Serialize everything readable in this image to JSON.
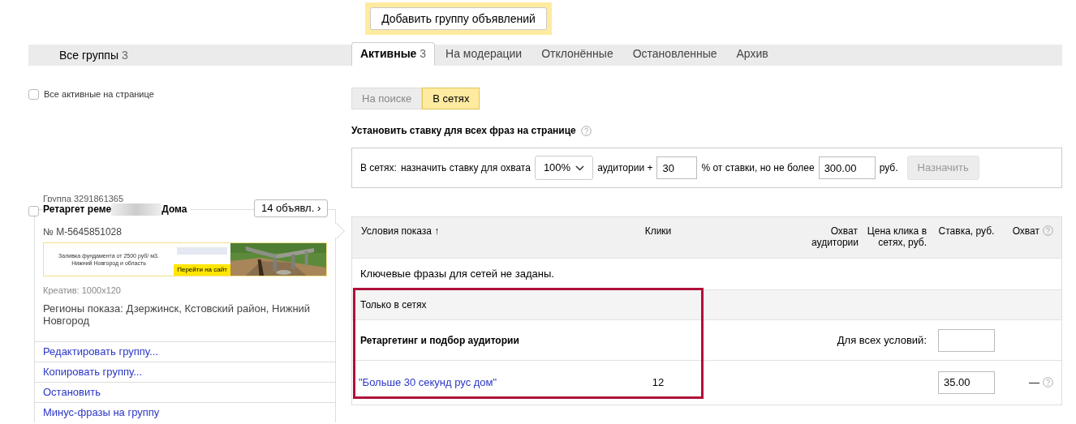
{
  "add_button": "Добавить группу объявлений",
  "all_groups": {
    "label": "Все группы",
    "count": "3"
  },
  "tabs": [
    {
      "label": "Активные",
      "count": "3",
      "selected": true
    },
    {
      "label": "На модерации",
      "selected": false
    },
    {
      "label": "Отклонённые",
      "selected": false
    },
    {
      "label": "Остановленные",
      "selected": false
    },
    {
      "label": "Архив",
      "selected": false
    }
  ],
  "select_all": {
    "label": "Все активные на странице",
    "checked": false
  },
  "network_toggle": [
    {
      "label": "На поиске",
      "selected": false
    },
    {
      "label": "В сетях",
      "selected": true
    }
  ],
  "bid_section": {
    "title": "Установить ставку для всех фраз на странице",
    "prefix": "В сетях:",
    "text_1": "назначить ставку для охвата",
    "coverage": "100%",
    "text_2": "аудитории +",
    "percent": "30",
    "text_3": "% от ставки, но не более",
    "max_bid": "300.00",
    "currency": "руб.",
    "button": "Назначить",
    "button_disabled": true
  },
  "group": {
    "id_label": "Группа 3291861365",
    "checked": false,
    "title_start": "Ретаргет реме",
    "title_end": "Дома",
    "ads_button": "14 объявл. ›",
    "ad_number": "№ M-5645851028",
    "banner": {
      "headline": "Заливка фундамента от 2500 руб/ м3. Нижний Новгород и область",
      "button": "Перейти на сайт"
    },
    "creative": "Креатив: 1000x120",
    "regions": "Регионы показа: Дзержинск, Кстовский район, Нижний Новгород",
    "actions": [
      "Редактировать группу...",
      "Копировать группу...",
      "Остановить",
      "Минус-фразы на группу"
    ]
  },
  "table": {
    "columns": [
      "Условия показа ↑",
      "Клики",
      "Охват аудитории",
      "Цена клика в сетях, руб.",
      "Ставка, руб.",
      "Охват"
    ],
    "empty_message": "Ключевые фразы для сетей не заданы.",
    "section": "Только в сетях",
    "subsection": "Ретаргетинг и подбор аудитории",
    "all_conditions_label": "Для всех условий:",
    "rows": [
      {
        "condition": "\"Больше 30 секунд рус дом\"",
        "clicks": "12",
        "bid": "35.00",
        "coverage": "—"
      }
    ]
  }
}
